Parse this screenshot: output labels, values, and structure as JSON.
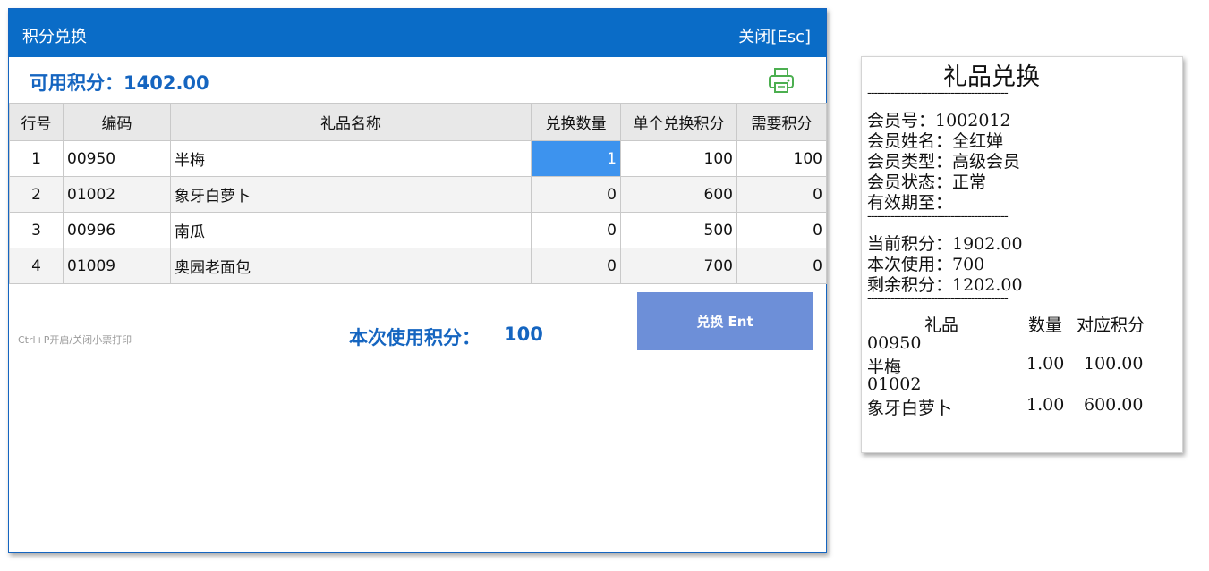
{
  "dialog": {
    "title": "积分兑换",
    "close_label": "关闭[Esc]",
    "available_points_label": "可用积分：1402.00",
    "print_icon": "printer-icon",
    "columns": [
      "行号",
      "编码",
      "礼品名称",
      "兑换数量",
      "单个兑换积分",
      "需要积分"
    ],
    "rows": [
      {
        "idx": "1",
        "code": "00950",
        "name": "半梅",
        "qty": "1",
        "unit": "100",
        "need": "100"
      },
      {
        "idx": "2",
        "code": "01002",
        "name": "象牙白萝卜",
        "qty": "0",
        "unit": "600",
        "need": "0"
      },
      {
        "idx": "3",
        "code": "00996",
        "name": "南瓜",
        "qty": "0",
        "unit": "500",
        "need": "0"
      },
      {
        "idx": "4",
        "code": "01009",
        "name": "奥园老面包",
        "qty": "0",
        "unit": "700",
        "need": "0"
      }
    ],
    "shortcut_hint": "Ctrl+P开启/关闭小票打印",
    "used_label": "本次使用积分：",
    "used_value": "100",
    "exchange_button": "兑换 Ent",
    "colors": {
      "titlebar": "#0a6cc7",
      "accent": "#1565c0",
      "selected_cell": "#3d93ee",
      "button": "#6d8fd8",
      "print_icon": "#4caf50"
    }
  },
  "receipt": {
    "title": "礼品兑换",
    "separator": "------------------------------------------",
    "member_no": "会员号：1002012",
    "member_name": "会员姓名：全红婵",
    "member_type": "会员类型：高级会员",
    "member_status": "会员状态：正常",
    "valid_until": "有效期至：",
    "current_points": "当前积分：1902.00",
    "used_points": "本次使用：700",
    "remaining_points": "剩余积分：1202.00",
    "header_gift": "礼品",
    "header_qty": "数量",
    "header_points": "对应积分",
    "items": [
      {
        "code": "00950",
        "name": "半梅",
        "qty": "1.00",
        "points": "100.00"
      },
      {
        "code": "01002",
        "name": "象牙白萝卜",
        "qty": "1.00",
        "points": "600.00"
      }
    ]
  }
}
